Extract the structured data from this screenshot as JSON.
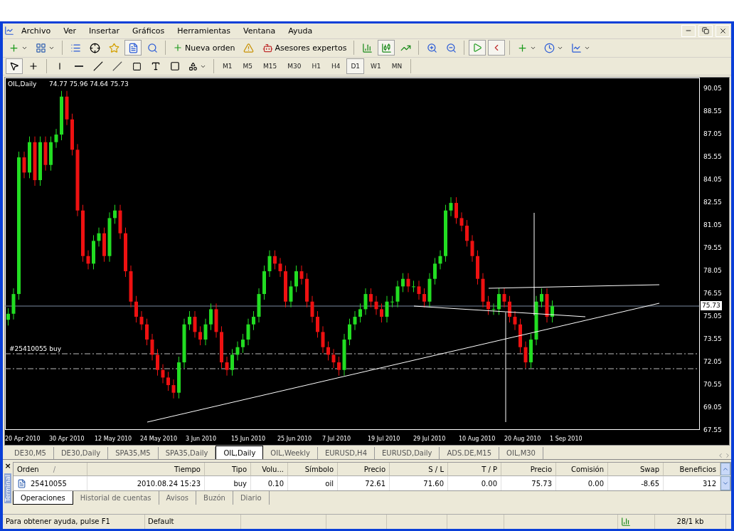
{
  "menu": [
    "Archivo",
    "Ver",
    "Insertar",
    "Gráficos",
    "Herramientas",
    "Ventana",
    "Ayuda"
  ],
  "toolbar": {
    "order_button": "Nueva orden",
    "experts_button": "Asesores expertos",
    "chart_styles": [
      {
        "selected": false
      },
      {
        "selected": true
      },
      {
        "selected": false
      }
    ]
  },
  "timeframes": [
    {
      "label": "M1",
      "selected": false
    },
    {
      "label": "M5",
      "selected": false
    },
    {
      "label": "M15",
      "selected": false
    },
    {
      "label": "M30",
      "selected": false
    },
    {
      "label": "H1",
      "selected": false
    },
    {
      "label": "H4",
      "selected": false
    },
    {
      "label": "D1",
      "selected": true
    },
    {
      "label": "W1",
      "selected": false
    },
    {
      "label": "MN",
      "selected": false
    }
  ],
  "chart": {
    "symbol": "OIL,Daily",
    "ohlc": "74.77 75.96 74.64 75.73",
    "order_label": "#25410055 buy",
    "bid_label": "75.73",
    "price_ticks": [
      "90.05",
      "88.55",
      "87.05",
      "85.55",
      "84.05",
      "82.55",
      "81.05",
      "79.55",
      "78.05",
      "76.55",
      "75.05",
      "73.55",
      "72.05",
      "70.55",
      "69.05",
      "67.55"
    ],
    "date_labels": [
      "20 Apr 2010",
      "30 Apr 2010",
      "12 May 2010",
      "24 May 2010",
      "3 Jun 2010",
      "15 Jun 2010",
      "25 Jun 2010",
      "7 Jul 2010",
      "19 Jul 2010",
      "29 Jul 2010",
      "10 Aug 2010",
      "20 Aug 2010",
      "1 Sep 2010"
    ]
  },
  "chart_tabs": [
    {
      "label": "DE30,M5",
      "selected": false
    },
    {
      "label": "DE30,Daily",
      "selected": false
    },
    {
      "label": "SPA35,M5",
      "selected": false
    },
    {
      "label": "SPA35,Daily",
      "selected": false
    },
    {
      "label": "OIL,Daily",
      "selected": true
    },
    {
      "label": "OIL,Weekly",
      "selected": false
    },
    {
      "label": "EURUSD,H4",
      "selected": false
    },
    {
      "label": "EURUSD,Daily",
      "selected": false
    },
    {
      "label": "ADS.DE,M15",
      "selected": false
    },
    {
      "label": "OIL,M30",
      "selected": false
    }
  ],
  "terminal": {
    "side_label": "Terminal",
    "close": "×",
    "columns": [
      {
        "label": "Orden",
        "sort": "/"
      },
      {
        "label": "Tiempo"
      },
      {
        "label": "Tipo"
      },
      {
        "label": "Volu..."
      },
      {
        "label": "Símbolo"
      },
      {
        "label": "Precio"
      },
      {
        "label": "S / L"
      },
      {
        "label": "T / P"
      },
      {
        "label": "Precio"
      },
      {
        "label": "Comisión"
      },
      {
        "label": "Swap"
      },
      {
        "label": "Beneficios"
      }
    ],
    "rows": [
      {
        "cells": [
          "25410055",
          "2010.08.24 15:23",
          "buy",
          "0.10",
          "oil",
          "72.61",
          "71.60",
          "0.00",
          "75.73",
          "0.00",
          "-8.65",
          "312"
        ]
      }
    ],
    "tabs": [
      {
        "label": "Operaciones",
        "selected": true
      },
      {
        "label": "Historial de cuentas",
        "selected": false
      },
      {
        "label": "Avisos",
        "selected": false
      },
      {
        "label": "Buzón",
        "selected": false
      },
      {
        "label": "Diario",
        "selected": false
      }
    ]
  },
  "status_bar": {
    "help": "Para obtener ayuda, pulse F1",
    "profile": "Default",
    "traffic": "28/1 kb"
  }
}
